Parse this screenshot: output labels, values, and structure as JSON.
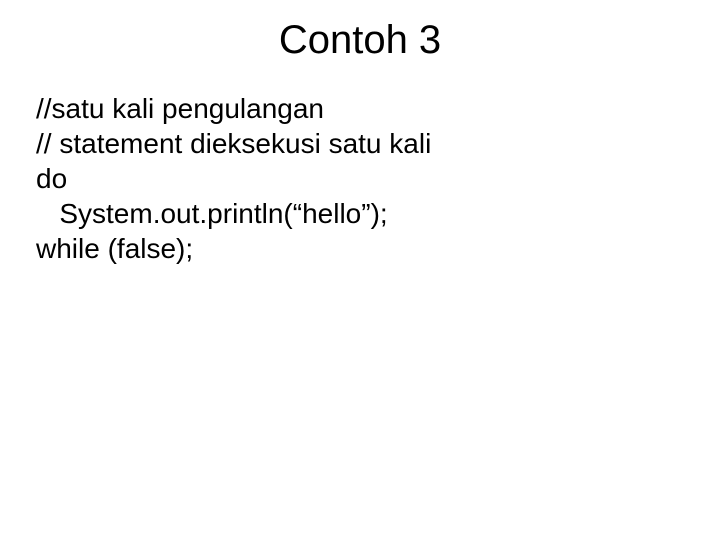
{
  "slide": {
    "title": "Contoh 3",
    "lines": {
      "l1": "//satu kali pengulangan",
      "l2": "// statement dieksekusi satu kali",
      "l3": "do",
      "l4": "   System.out.println(“hello”);",
      "l5": "while (false);"
    }
  }
}
